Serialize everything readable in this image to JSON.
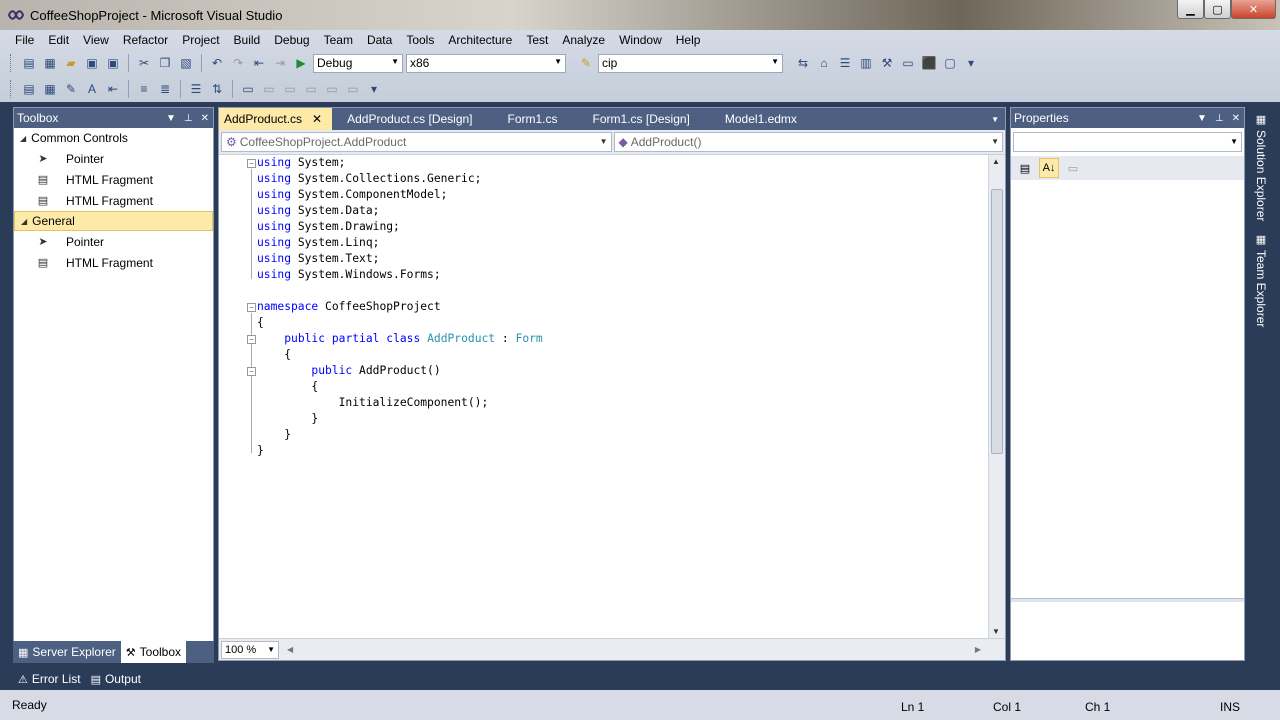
{
  "window": {
    "title": "CoffeeShopProject - Microsoft Visual Studio",
    "controls": [
      "minimize",
      "maximize",
      "close"
    ]
  },
  "menu": [
    "File",
    "Edit",
    "View",
    "Refactor",
    "Project",
    "Build",
    "Debug",
    "Team",
    "Data",
    "Tools",
    "Architecture",
    "Test",
    "Analyze",
    "Window",
    "Help"
  ],
  "toolbar": {
    "config": "Debug",
    "platform": "x86",
    "find": "cip"
  },
  "toolbox": {
    "title": "Toolbox",
    "groups": [
      {
        "label": "Common Controls",
        "items": [
          "Pointer",
          "HTML Fragment",
          "HTML Fragment"
        ]
      },
      {
        "label": "General",
        "items": [
          "Pointer",
          "HTML Fragment"
        ]
      }
    ],
    "tabs": [
      "Server Explorer",
      "Toolbox"
    ]
  },
  "editor": {
    "tabs": [
      "AddProduct.cs",
      "AddProduct.cs [Design]",
      "Form1.cs",
      "Form1.cs [Design]",
      "Model1.edmx"
    ],
    "active_tab": "AddProduct.cs",
    "type_nav": "CoffeeShopProject.AddProduct",
    "member_nav": "AddProduct()",
    "zoom": "100 %",
    "code": {
      "usings": [
        "System",
        "System.Collections.Generic",
        "System.ComponentModel",
        "System.Data",
        "System.Drawing",
        "System.Linq",
        "System.Text",
        "System.Windows.Forms"
      ],
      "namespace": "CoffeeShopProject",
      "class_name": "AddProduct",
      "base_class": "Form",
      "constructor": "AddProduct()",
      "call": "InitializeComponent();"
    }
  },
  "properties": {
    "title": "Properties"
  },
  "side_tabs": [
    "Solution Explorer",
    "Team Explorer"
  ],
  "bottom_tabs": [
    "Error List",
    "Output"
  ],
  "status": {
    "message": "Ready",
    "line": "Ln 1",
    "col": "Col 1",
    "ch": "Ch 1",
    "mode": "INS"
  }
}
